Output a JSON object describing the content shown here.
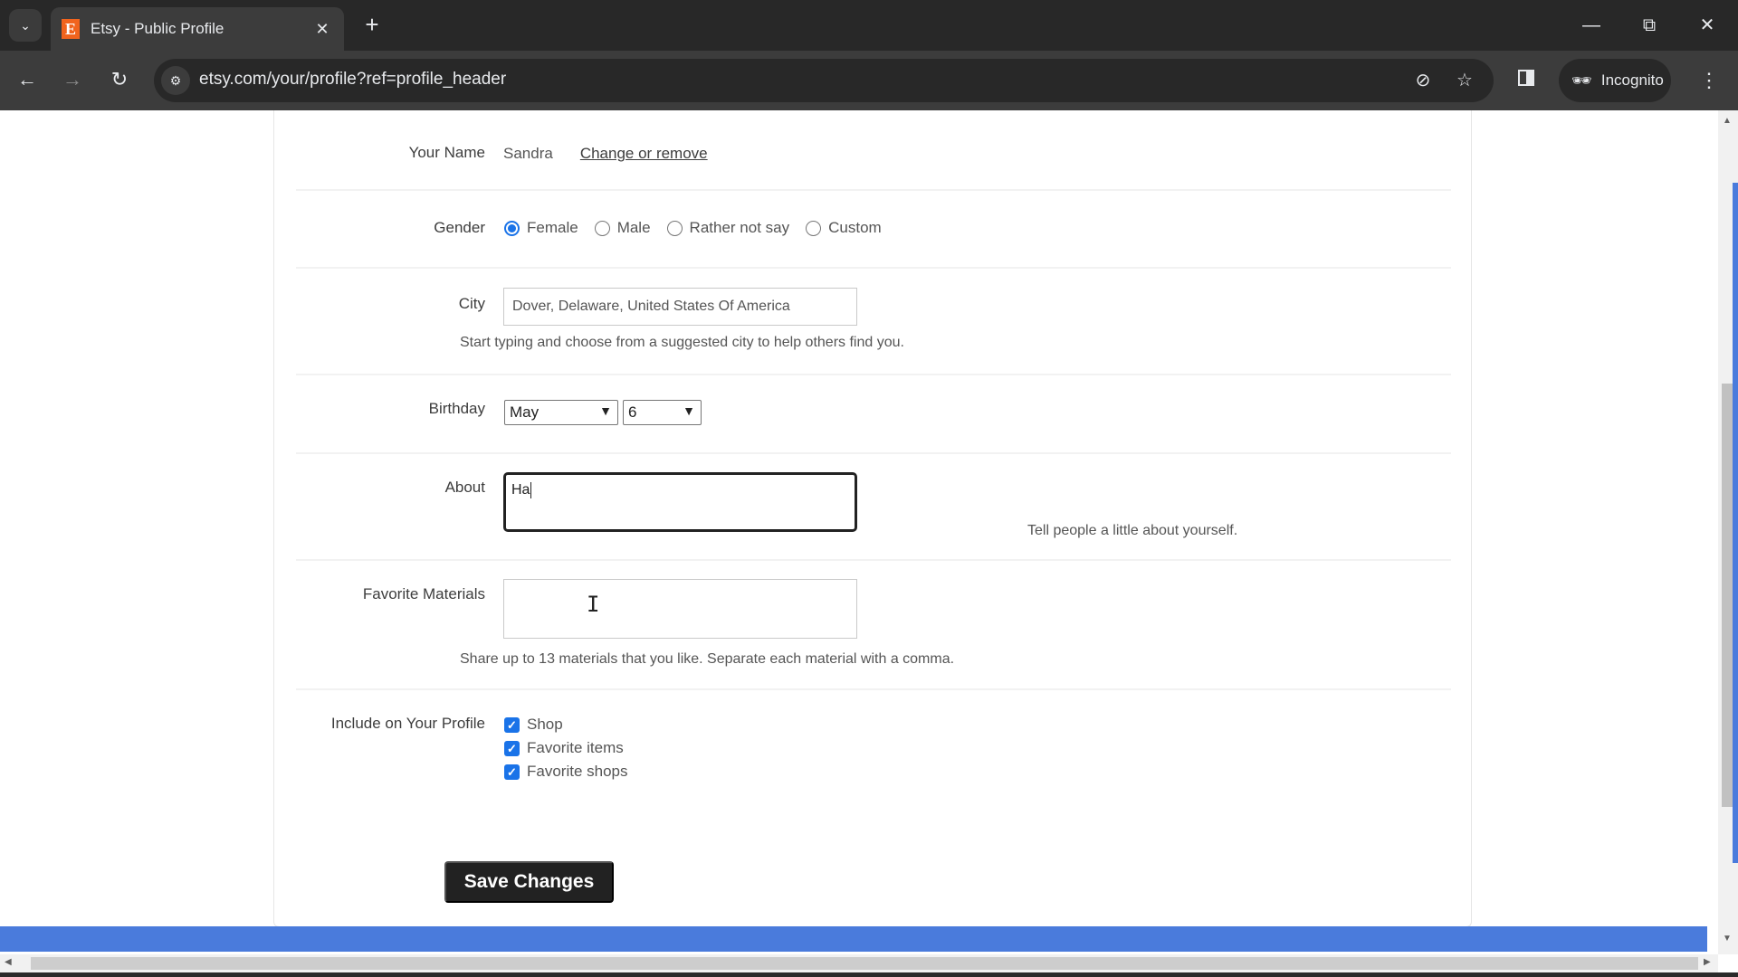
{
  "browser": {
    "tab_title": "Etsy - Public Profile",
    "favicon_letter": "E",
    "url": "etsy.com/your/profile?ref=profile_header",
    "incognito_label": "Incognito",
    "accent": "#f1641e"
  },
  "form": {
    "name": {
      "label": "Your Name",
      "value": "Sandra",
      "link": "Change or remove"
    },
    "gender": {
      "label": "Gender",
      "options": [
        {
          "label": "Female",
          "selected": true
        },
        {
          "label": "Male",
          "selected": false
        },
        {
          "label": "Rather not say",
          "selected": false
        },
        {
          "label": "Custom",
          "selected": false
        }
      ]
    },
    "city": {
      "label": "City",
      "value": "Dover, Delaware, United States Of America",
      "help": "Start typing and choose from a suggested city to help others find you."
    },
    "birthday": {
      "label": "Birthday",
      "month": "May",
      "day": "6"
    },
    "about": {
      "label": "About",
      "value": "Ha",
      "help": "Tell people a little about yourself."
    },
    "materials": {
      "label": "Favorite Materials",
      "value": "",
      "help": "Share up to 13 materials that you like. Separate each material with a comma."
    },
    "include": {
      "label": "Include on Your Profile",
      "options": [
        {
          "label": "Shop",
          "checked": true
        },
        {
          "label": "Favorite items",
          "checked": true
        },
        {
          "label": "Favorite shops",
          "checked": true
        }
      ]
    },
    "save_label": "Save Changes"
  },
  "colors": {
    "checkbox_blue": "#1a73e8",
    "footer_bar": "#4a7bdc",
    "save_button_bg": "#222222"
  }
}
